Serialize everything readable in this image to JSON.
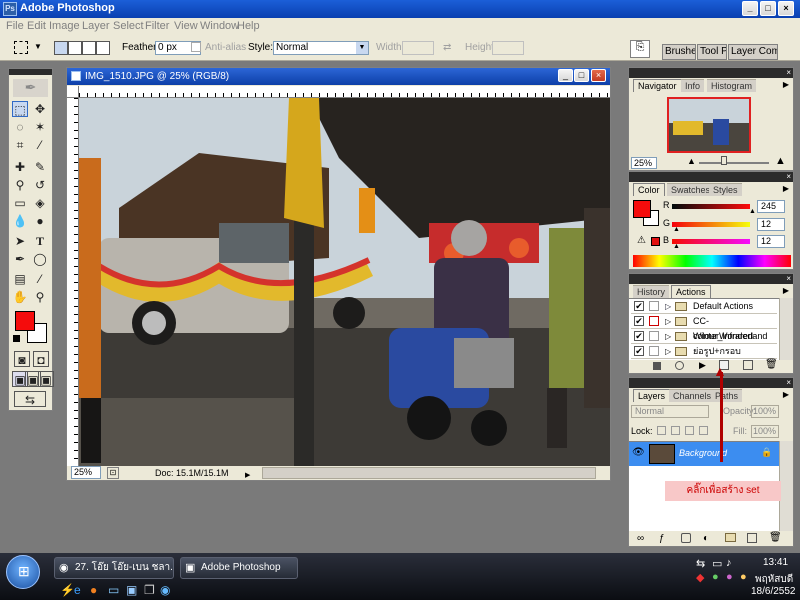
{
  "app": {
    "title": "Adobe Photoshop",
    "icon_label": "Ps",
    "window_buttons": [
      "_",
      "□",
      "×"
    ]
  },
  "menu": [
    "File",
    "Edit",
    "Image",
    "Layer",
    "Select",
    "Filter",
    "View",
    "Window",
    "Help"
  ],
  "options_bar": {
    "feather_label": "Feather:",
    "feather_value": "0 px",
    "antialias_label": "Anti-alias",
    "style_label": "Style:",
    "style_value": "Normal",
    "width_label": "Width:",
    "height_label": "Height:"
  },
  "palette_well_tabs": [
    "Brushes",
    "Tool Pr",
    "Layer Comps"
  ],
  "document": {
    "title": "IMG_1510.JPG @ 25% (RGB/8)",
    "zoom": "25%",
    "doc_size": "Doc: 15.1M/15.1M"
  },
  "navigator_panel": {
    "tabs": [
      "Navigator",
      "Info",
      "Histogram"
    ],
    "zoom": "25%"
  },
  "color_panel": {
    "tabs": [
      "Color",
      "Swatches",
      "Styles"
    ],
    "r_label": "R",
    "r_value": "245",
    "g_label": "G",
    "g_value": "12",
    "b_label": "B",
    "b_value": "12",
    "fg_color": "#f50c0c"
  },
  "actions_panel": {
    "tabs": [
      "History",
      "Actions"
    ],
    "items": [
      {
        "label": "Default Actions"
      },
      {
        "label": "CC-WinterWonderland"
      },
      {
        "label": "colour_infrared"
      },
      {
        "label": "ย่อรูป+กรอบ"
      }
    ]
  },
  "layers_panel": {
    "tabs": [
      "Layers",
      "Channels",
      "Paths"
    ],
    "blend_mode": "Normal",
    "opacity_label": "Opacity:",
    "opacity_value": "100%",
    "lock_label": "Lock:",
    "fill_label": "Fill:",
    "fill_value": "100%",
    "layer_name": "Background"
  },
  "annotation": {
    "text": "คลิ๊กเพื่อสร้าง set",
    "color": "#cc0000"
  },
  "taskbar": {
    "buttons": [
      "27. โอ๊ย โอ๊ย-เบน ชลา...",
      "Adobe Photoshop"
    ],
    "time": "13:41",
    "day": "พฤหัสบดี",
    "date": "18/6/2552"
  },
  "colors": {
    "accent_blue": "#316ac5",
    "panel_bg": "#ece9d8",
    "layer_selected": "#3c8df0"
  }
}
